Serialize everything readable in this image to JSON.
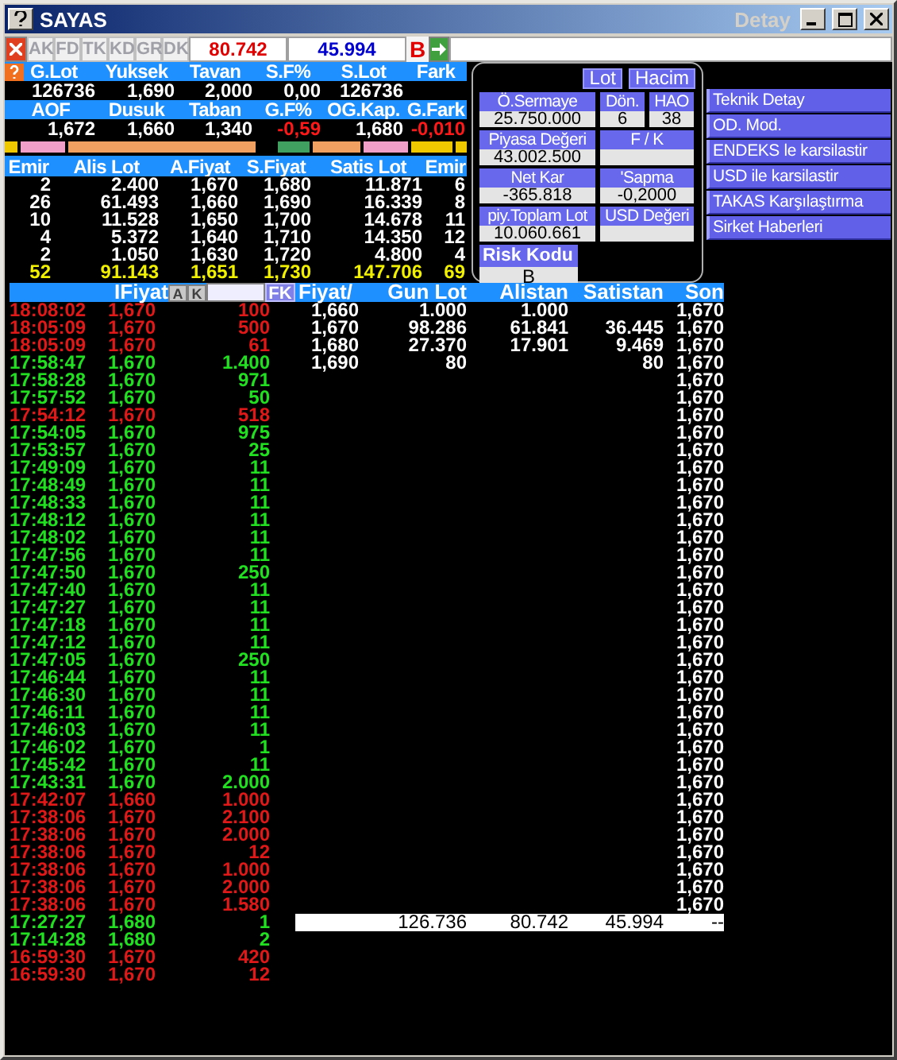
{
  "window": {
    "title": "SAYAS",
    "detail_label": "Detay"
  },
  "toolbar": {
    "tabs": [
      "AK",
      "FD",
      "TK",
      "KD",
      "GR",
      "DK"
    ],
    "buy_total": "80.742",
    "sell_total": "45.994",
    "flag": "B"
  },
  "summary": [
    {
      "headers": [
        "G.Lot",
        "Yuksek",
        "Tavan",
        "S.F%",
        "S.Lot",
        "Fark"
      ],
      "values": [
        {
          "text": "126736",
          "negative": false
        },
        {
          "text": "1,690",
          "negative": false
        },
        {
          "text": "2,000",
          "negative": false
        },
        {
          "text": "0,00",
          "negative": false
        },
        {
          "text": "126736",
          "negative": false
        }
      ]
    },
    {
      "headers": [
        "AOF",
        "Dusuk",
        "Taban",
        "G.F%",
        "OG.Kap.",
        "G.Fark"
      ],
      "values": [
        {
          "text": "1,672",
          "negative": false
        },
        {
          "text": "1,660",
          "negative": false
        },
        {
          "text": "1,340",
          "negative": false
        },
        {
          "text": "-0,59",
          "negative": true
        },
        {
          "text": "1,680",
          "negative": false
        },
        {
          "text": "-0,010",
          "negative": true
        }
      ]
    }
  ],
  "depth": {
    "columns": [
      "Emir",
      "Alis Lot",
      "A.Fiyat",
      "S.Fiyat",
      "Satis Lot",
      "Emir"
    ],
    "rows": [
      [
        "2",
        "2.400",
        "1,670",
        "1,680",
        "11.871",
        "6"
      ],
      [
        "26",
        "61.493",
        "1,660",
        "1,690",
        "16.339",
        "8"
      ],
      [
        "10",
        "11.528",
        "1,650",
        "1,700",
        "14.678",
        "11"
      ],
      [
        "4",
        "5.372",
        "1,640",
        "1,710",
        "14.350",
        "12"
      ],
      [
        "2",
        "1.050",
        "1,630",
        "1,720",
        "4.800",
        "4"
      ]
    ],
    "totals": [
      "52",
      "91.143",
      "1,651",
      "1,730",
      "147.706",
      "69"
    ]
  },
  "stats": {
    "toggles": [
      "Lot",
      "Hacim"
    ],
    "rows": [
      [
        {
          "label": "Ö.Sermaye",
          "value": "25.750.000"
        },
        {
          "label": "Dön.",
          "value": "6"
        },
        {
          "label": "HAO",
          "value": "38"
        }
      ],
      [
        {
          "label": "Piyasa Değeri",
          "value": "43.002.500"
        },
        {
          "label": "F / K"
        }
      ],
      [
        {
          "label": "Net Kar",
          "value": "-365.818"
        },
        {
          "label": "'Sapma",
          "value": "-0,2000"
        }
      ],
      [
        {
          "label": "piy.Toplam Lot",
          "value": "10.060.661"
        },
        {
          "label": "USD Değeri"
        }
      ]
    ],
    "risk": {
      "label": "Risk Kodu",
      "value": "B"
    }
  },
  "side_buttons": [
    "Teknik Detay",
    "OD. Mod.",
    "ENDEKS le karsilastir",
    "USD ile karsilastir",
    "TAKAS Karşılaştırma",
    "Sirket Haberleri"
  ],
  "trades": {
    "header": "IFiyat",
    "buttons": [
      "A",
      "K"
    ],
    "filter_button": "FK",
    "rows": [
      {
        "time": "18:08:02",
        "price": "1,670",
        "lot": "100",
        "color": "#e01818"
      },
      {
        "time": "18:05:09",
        "price": "1,670",
        "lot": "500",
        "color": "#e01818"
      },
      {
        "time": "18:05:09",
        "price": "1,670",
        "lot": "61",
        "color": "#e01818"
      },
      {
        "time": "17:58:47",
        "price": "1,670",
        "lot": "1.400",
        "color": "#20e020"
      },
      {
        "time": "17:58:28",
        "price": "1,670",
        "lot": "971",
        "color": "#20e020"
      },
      {
        "time": "17:57:52",
        "price": "1,670",
        "lot": "50",
        "color": "#20e020"
      },
      {
        "time": "17:54:12",
        "price": "1,670",
        "lot": "518",
        "color": "#e01818"
      },
      {
        "time": "17:54:05",
        "price": "1,670",
        "lot": "975",
        "color": "#20e020"
      },
      {
        "time": "17:53:57",
        "price": "1,670",
        "lot": "25",
        "color": "#20e020"
      },
      {
        "time": "17:49:09",
        "price": "1,670",
        "lot": "11",
        "color": "#20e020"
      },
      {
        "time": "17:48:49",
        "price": "1,670",
        "lot": "11",
        "color": "#20e020"
      },
      {
        "time": "17:48:33",
        "price": "1,670",
        "lot": "11",
        "color": "#20e020"
      },
      {
        "time": "17:48:12",
        "price": "1,670",
        "lot": "11",
        "color": "#20e020"
      },
      {
        "time": "17:48:02",
        "price": "1,670",
        "lot": "11",
        "color": "#20e020"
      },
      {
        "time": "17:47:56",
        "price": "1,670",
        "lot": "11",
        "color": "#20e020"
      },
      {
        "time": "17:47:50",
        "price": "1,670",
        "lot": "250",
        "color": "#20e020"
      },
      {
        "time": "17:47:40",
        "price": "1,670",
        "lot": "11",
        "color": "#20e020"
      },
      {
        "time": "17:47:27",
        "price": "1,670",
        "lot": "11",
        "color": "#20e020"
      },
      {
        "time": "17:47:18",
        "price": "1,670",
        "lot": "11",
        "color": "#20e020"
      },
      {
        "time": "17:47:12",
        "price": "1,670",
        "lot": "11",
        "color": "#20e020"
      },
      {
        "time": "17:47:05",
        "price": "1,670",
        "lot": "250",
        "color": "#20e020"
      },
      {
        "time": "17:46:44",
        "price": "1,670",
        "lot": "11",
        "color": "#20e020"
      },
      {
        "time": "17:46:30",
        "price": "1,670",
        "lot": "11",
        "color": "#20e020"
      },
      {
        "time": "17:46:11",
        "price": "1,670",
        "lot": "11",
        "color": "#20e020"
      },
      {
        "time": "17:46:03",
        "price": "1,670",
        "lot": "11",
        "color": "#20e020"
      },
      {
        "time": "17:46:02",
        "price": "1,670",
        "lot": "1",
        "color": "#20e020"
      },
      {
        "time": "17:45:42",
        "price": "1,670",
        "lot": "11",
        "color": "#20e020"
      },
      {
        "time": "17:43:31",
        "price": "1,670",
        "lot": "2.000",
        "color": "#20e020"
      },
      {
        "time": "17:42:07",
        "price": "1,660",
        "lot": "1.000",
        "color": "#e01818"
      },
      {
        "time": "17:38:06",
        "price": "1,670",
        "lot": "2.100",
        "color": "#e01818"
      },
      {
        "time": "17:38:06",
        "price": "1,670",
        "lot": "2.000",
        "color": "#e01818"
      },
      {
        "time": "17:38:06",
        "price": "1,670",
        "lot": "12",
        "color": "#e01818"
      },
      {
        "time": "17:38:06",
        "price": "1,670",
        "lot": "1.000",
        "color": "#e01818"
      },
      {
        "time": "17:38:06",
        "price": "1,670",
        "lot": "2.000",
        "color": "#e01818"
      },
      {
        "time": "17:38:06",
        "price": "1,670",
        "lot": "1.580",
        "color": "#e01818"
      },
      {
        "time": "17:27:27",
        "price": "1,680",
        "lot": "1",
        "color": "#20e020"
      },
      {
        "time": "17:14:28",
        "price": "1,680",
        "lot": "2",
        "color": "#20e020"
      },
      {
        "time": "16:59:30",
        "price": "1,670",
        "lot": "420",
        "color": "#e01818"
      },
      {
        "time": "16:59:30",
        "price": "1,670",
        "lot": "12",
        "color": "#e01818"
      }
    ]
  },
  "price_table": {
    "columns": [
      "Fiyat/",
      "Gun Lot",
      "Alistan",
      "Satistan",
      "Son"
    ],
    "levels": [
      {
        "price": "1,660",
        "day_lot": "1.000",
        "bid": "1.000"
      },
      {
        "price": "1,670",
        "day_lot": "98.286",
        "bid": "61.841",
        "ask": "36.445"
      },
      {
        "price": "1,680",
        "day_lot": "27.370",
        "bid": "17.901",
        "ask": "9.469"
      },
      {
        "price": "1,690",
        "day_lot": "80",
        "ask": "80"
      }
    ],
    "last_prices": [
      "1,670",
      "1,670",
      "1,670",
      "1,670",
      "1,670",
      "1,670",
      "1,670",
      "1,670",
      "1,670",
      "1,670",
      "1,670",
      "1,670",
      "1,670",
      "1,670",
      "1,670",
      "1,670",
      "1,670",
      "1,670",
      "1,670",
      "1,670",
      "1,670",
      "1,670",
      "1,670",
      "1,670",
      "1,670",
      "1,670",
      "1,670",
      "1,670",
      "1,670",
      "1,670",
      "1,670",
      "1,670",
      "1,670",
      "1,670",
      "1,670"
    ],
    "totals": [
      "126.736",
      "80.742",
      "45.994",
      "--"
    ]
  }
}
